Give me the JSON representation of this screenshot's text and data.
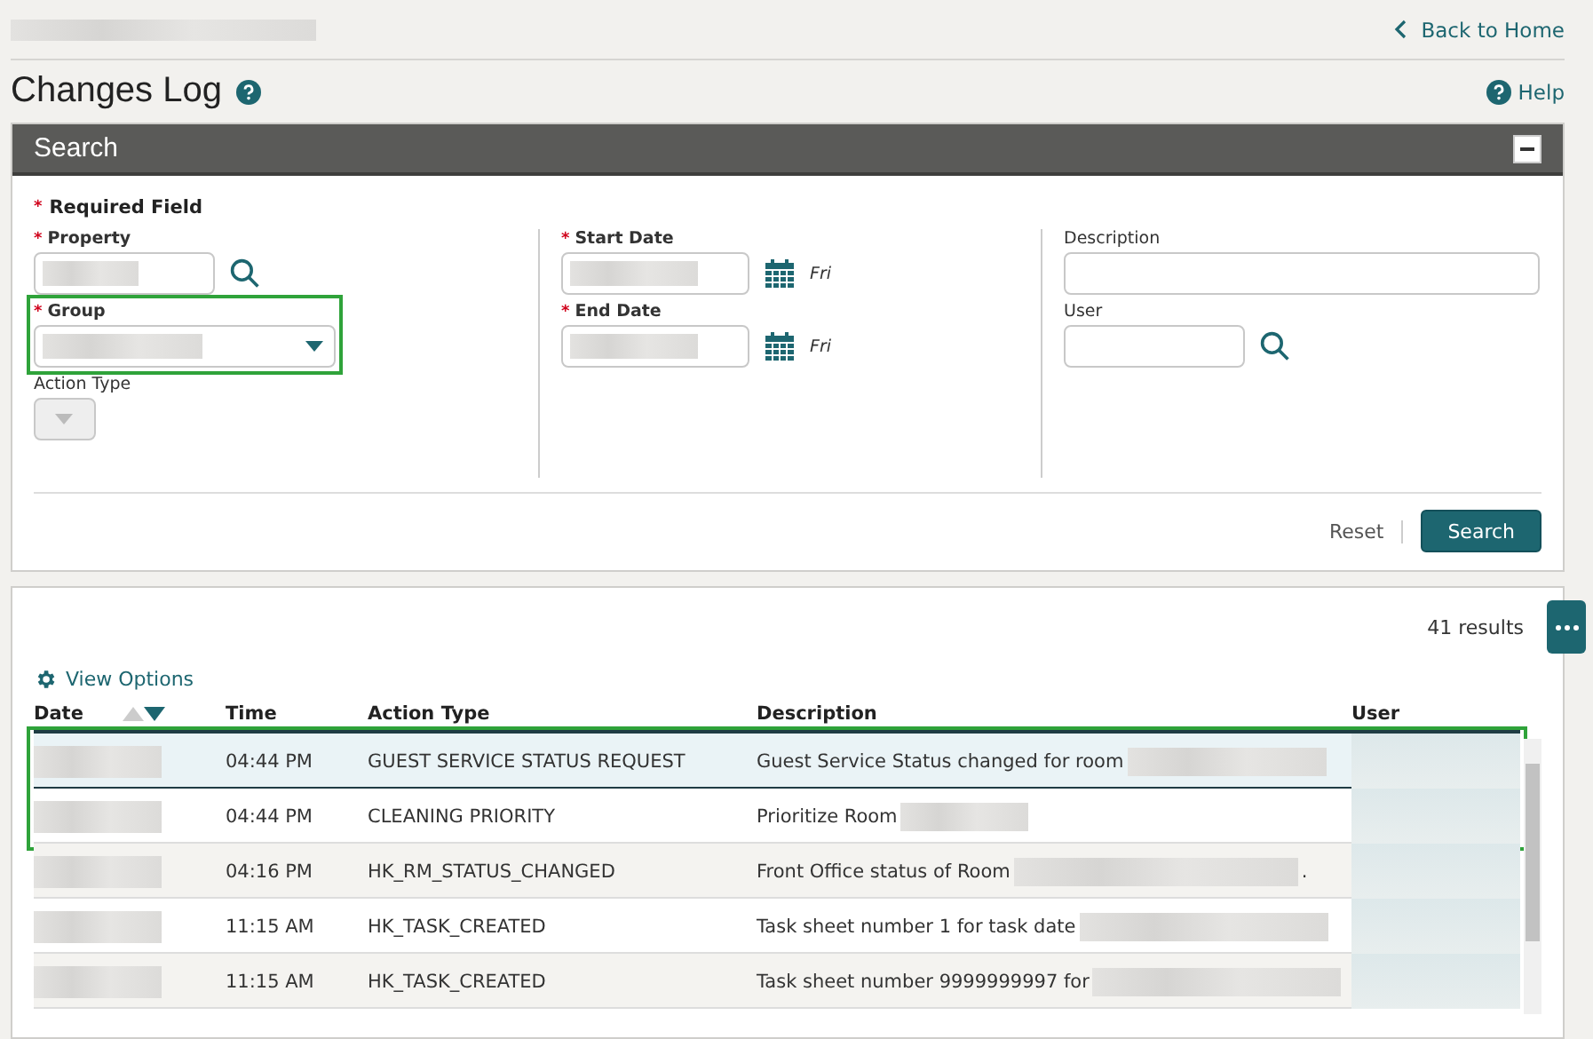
{
  "top_bar": {
    "back_link": "Back to Home"
  },
  "page": {
    "title": "Changes Log",
    "help_link": "Help"
  },
  "search_panel": {
    "title": "Search",
    "expanded": true,
    "required_mark": "*",
    "required_note": "Required Field",
    "sections": [
      {
        "fields": [
          {
            "label": "Property",
            "required": true,
            "kind": "lookup",
            "filled": true,
            "outlined": false
          },
          {
            "label": "Group",
            "required": true,
            "kind": "select",
            "outlined": true
          },
          {
            "label": "Action Type",
            "required": false,
            "kind": "small-select",
            "disabled": true,
            "outlined": false
          }
        ]
      },
      {
        "fields": [
          {
            "label": "Start Date",
            "required": true,
            "kind": "date",
            "day": "Fri",
            "outlined": false
          },
          {
            "label": "End Date",
            "required": true,
            "kind": "date",
            "day": "Fri",
            "outlined": false
          }
        ]
      },
      {
        "fields": [
          {
            "label": "Description",
            "required": false,
            "kind": "text"
          },
          {
            "label": "User",
            "required": false,
            "kind": "lookup",
            "filled": false,
            "outlined": false
          }
        ]
      }
    ],
    "reset": "Reset",
    "submit": "Search"
  },
  "results": {
    "count": "41 results",
    "view_options": "View Options",
    "columns": [
      "Date",
      "Time",
      "Action Type",
      "Description",
      "User"
    ],
    "rows": [
      {
        "time": "04:44 PM",
        "action_type": "GUEST SERVICE STATUS REQUEST",
        "description": "Guest Service Status changed for room",
        "selected": true,
        "outlined": true
      },
      {
        "time": "04:44 PM",
        "action_type": "CLEANING PRIORITY",
        "description": "Prioritize Room",
        "selected": false,
        "outlined": true
      },
      {
        "time": "04:16 PM",
        "action_type": "HK_RM_STATUS_CHANGED",
        "description": "Front Office status of Room",
        "suffix": ".",
        "selected": false,
        "outlined": false
      },
      {
        "time": "11:15 AM",
        "action_type": "HK_TASK_CREATED",
        "description": "Task sheet number 1 for task date",
        "selected": false,
        "outlined": false
      },
      {
        "time": "11:15 AM",
        "action_type": "HK_TASK_CREATED",
        "description": "Task sheet number 9999999997 for",
        "selected": false,
        "outlined": false
      }
    ]
  }
}
